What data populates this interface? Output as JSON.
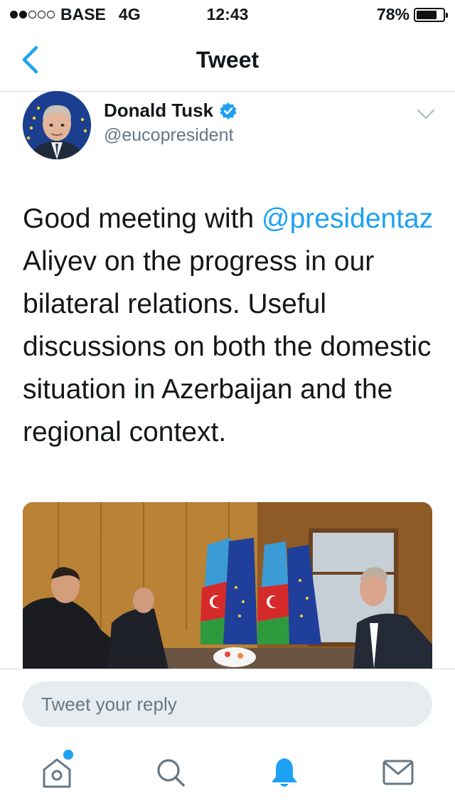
{
  "status_bar": {
    "carrier": "BASE",
    "network": "4G",
    "time": "12:43",
    "battery": "78%",
    "battery_level": 0.78,
    "signal_bars_filled": 2,
    "signal_bars_total": 5
  },
  "nav": {
    "title": "Tweet",
    "back_icon": "chevron-left-icon"
  },
  "tweet": {
    "author_name": "Donald Tusk",
    "author_handle": "@eucopresident",
    "verified": true,
    "text_before_mention": "Good meeting with ",
    "mention": "@presidentaz",
    "text_after_mention": " Aliyev on the progress in our bilateral relations. Useful discussions on both the domestic situation in Azerbaijan and the regional context.",
    "media_icon": "photo-meeting-image"
  },
  "reply": {
    "placeholder": "Tweet your reply"
  },
  "tab_bar": {
    "items": [
      "home-icon",
      "search-icon",
      "notifications-icon",
      "messages-icon"
    ],
    "active": "notifications-icon",
    "home_has_badge": true
  },
  "colors": {
    "accent": "#1da1f2",
    "text": "#14171a",
    "secondary_text": "#657786",
    "divider": "#d6d9dc",
    "reply_bg": "#e6ecf0",
    "inactive_icon": "#657786"
  }
}
